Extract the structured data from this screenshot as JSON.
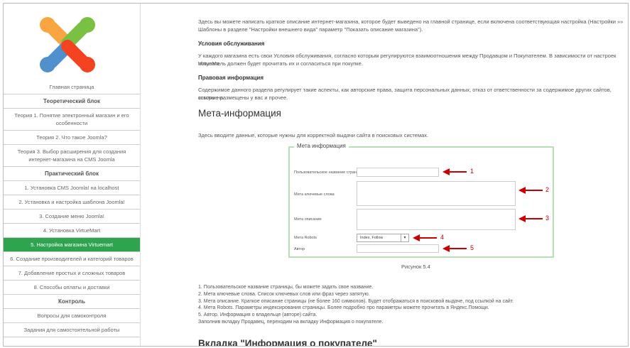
{
  "sidebar": {
    "items": [
      {
        "label": "Главная страница",
        "type": "link"
      },
      {
        "label": "Теоретический блок",
        "type": "head"
      },
      {
        "label": "Теория 1. Понятие электронный магазин и его особенности",
        "type": "link"
      },
      {
        "label": "Теория 2. Что такое Joomla?",
        "type": "link"
      },
      {
        "label": "Теория 3. Выбор расширения для создания интернет-магазина на CMS Joomla",
        "type": "link"
      },
      {
        "label": "Практический блок",
        "type": "head"
      },
      {
        "label": "1. Установка CMS Joomla! на localhost",
        "type": "link"
      },
      {
        "label": "2. Установка и настройка шаблона Joomla!",
        "type": "link"
      },
      {
        "label": "3. Создание меню Joomla!",
        "type": "link"
      },
      {
        "label": "4. Установка VirtueMart",
        "type": "link"
      },
      {
        "label": "5. Настройка магазина Virtuemart",
        "type": "active"
      },
      {
        "label": "6. Создание производителей и категорий товаров",
        "type": "link"
      },
      {
        "label": "7. Добавление простых и сложных товаров",
        "type": "link"
      },
      {
        "label": "8. Способы оплаты и доставки",
        "type": "link"
      },
      {
        "label": "Контроль",
        "type": "head"
      },
      {
        "label": "Вопросы для самоконтроля",
        "type": "link"
      },
      {
        "label": "Задания для самостоятельной работы",
        "type": "link"
      }
    ]
  },
  "content": {
    "intro_line1": "Здесь вы можете написать краткое описание интернет-магазина, которое будет выведено на главной странице, если включена соответствующая настройка (Настройки »»",
    "intro_line2": "Шаблоны в разделе \"Настройки внешнего вида\" параметр \"Показать описание магазина\").",
    "terms_heading": "Условия обслуживания",
    "terms_line1": "У каждого магазина есть свои Условия обслуживания, согласно которым регулируются взаимоотношения между Продавцом и Покупателем. В зависимости от настроек VirtueMa",
    "terms_line2": "покупатель должен будет прочитать их и согласиться при покупке.",
    "legal_heading": "Правовая информация",
    "legal_line1": "Содержимое данного раздела регулирует такие аспекты, как авторские права, защита персональных данных, отказ от ответственности за содержимое других сайтов, ссылки на",
    "legal_line2": "которые размещены у вас и прочее.",
    "meta_heading": "Мета-информация",
    "meta_intro": "Здесь вводите данные, которые нужны для корректной выдачи сайта в поисковых системах.",
    "figure": {
      "legend": "Мета информация",
      "fields": {
        "page_title_label": "Пользовательское название страницы",
        "keywords_label": "Мета ключевые слова",
        "description_label": "Мета описание",
        "robots_label": "Мета Robots",
        "robots_value": "Index, Follow",
        "author_label": "Автор"
      },
      "markers": [
        "1",
        "2",
        "3",
        "4",
        "5"
      ],
      "caption": "Рисунок 5.4"
    },
    "list": [
      "1. Пользовательское название страницы, бы можете задать свое название.",
      "2. Мета ключевые слова. Список ключевых слов или фраз через запятую.",
      "3. Мета описание. Краткое описание страницы (не более 160 символов). Будет отображаться в поисковой выдаче, под ссылкой на сайт.",
      "4. Мета Robots. Параметры индексирования страницы. Более подробно про параметры можете прочитать в Яндекс.Помощи.",
      "5. Автор. Информация о владельце (авторе) сайта.",
      "Заполнив вкладку Продавец, переходим на вкладку Информация о покупателе."
    ],
    "next_heading": "Вкладка \"Информация о покупателе\""
  },
  "colors": {
    "active": "#2ea44f",
    "arrow": "#cc0000",
    "fieldset": "#b9dfb9"
  },
  "icons": [
    "joomla-logo-icon",
    "red-arrow-icon",
    "dropdown-arrow-icon"
  ]
}
